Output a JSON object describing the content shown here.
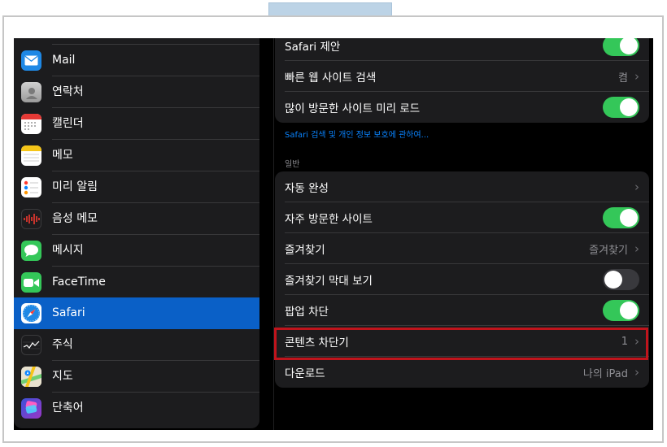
{
  "sidebar": {
    "items": [
      {
        "label": "Mail",
        "icon": "mail-icon",
        "color": "#1e88e5",
        "selected": false
      },
      {
        "label": "연락처",
        "icon": "contacts-icon",
        "color": "#a9a9a9",
        "selected": false
      },
      {
        "label": "캘린더",
        "icon": "calendar-icon",
        "color": "#ffffff",
        "selected": false
      },
      {
        "label": "메모",
        "icon": "notes-icon",
        "color": "#ffffff",
        "selected": false
      },
      {
        "label": "미리 알림",
        "icon": "reminders-icon",
        "color": "#ffffff",
        "selected": false
      },
      {
        "label": "음성 메모",
        "icon": "voice-memos-icon",
        "color": "#1c1c1e",
        "selected": false
      },
      {
        "label": "메시지",
        "icon": "messages-icon",
        "color": "#34c759",
        "selected": false
      },
      {
        "label": "FaceTime",
        "icon": "facetime-icon",
        "color": "#34c759",
        "selected": false
      },
      {
        "label": "Safari",
        "icon": "safari-icon",
        "color": "#ffffff",
        "selected": true
      },
      {
        "label": "주식",
        "icon": "stocks-icon",
        "color": "#1c1c1e",
        "selected": false
      },
      {
        "label": "지도",
        "icon": "maps-icon",
        "color": "#6fcf73",
        "selected": false
      },
      {
        "label": "단축어",
        "icon": "shortcuts-icon",
        "color": "#6a4cf5",
        "selected": false
      }
    ]
  },
  "search_group": {
    "rows": [
      {
        "label": "Safari 제안",
        "type": "toggle",
        "on": true
      },
      {
        "label": "빠른 웹 사이트 검색",
        "type": "value",
        "value": "켬"
      },
      {
        "label": "많이 방문한 사이트 미리 로드",
        "type": "toggle",
        "on": true
      }
    ]
  },
  "privacy_link": "Safari 검색 및 개인 정보 보호에 관하여...",
  "general_header": "일반",
  "general_group": {
    "rows": [
      {
        "label": "자동 완성",
        "type": "value",
        "value": ""
      },
      {
        "label": "자주 방문한 사이트",
        "type": "toggle",
        "on": true
      },
      {
        "label": "즐겨찾기",
        "type": "value",
        "value": "즐겨찾기"
      },
      {
        "label": "즐겨찾기 막대 보기",
        "type": "toggle",
        "on": false
      },
      {
        "label": "팝업 차단",
        "type": "toggle",
        "on": true
      },
      {
        "label": "콘텐츠 차단기",
        "type": "value",
        "value": "1"
      },
      {
        "label": "다운로드",
        "type": "value",
        "value": "나의 iPad"
      }
    ]
  },
  "colors": {
    "accent": "#0a84ff",
    "selected": "#0a60c7",
    "toggle_on": "#34c759",
    "highlight": "#c0141c"
  }
}
